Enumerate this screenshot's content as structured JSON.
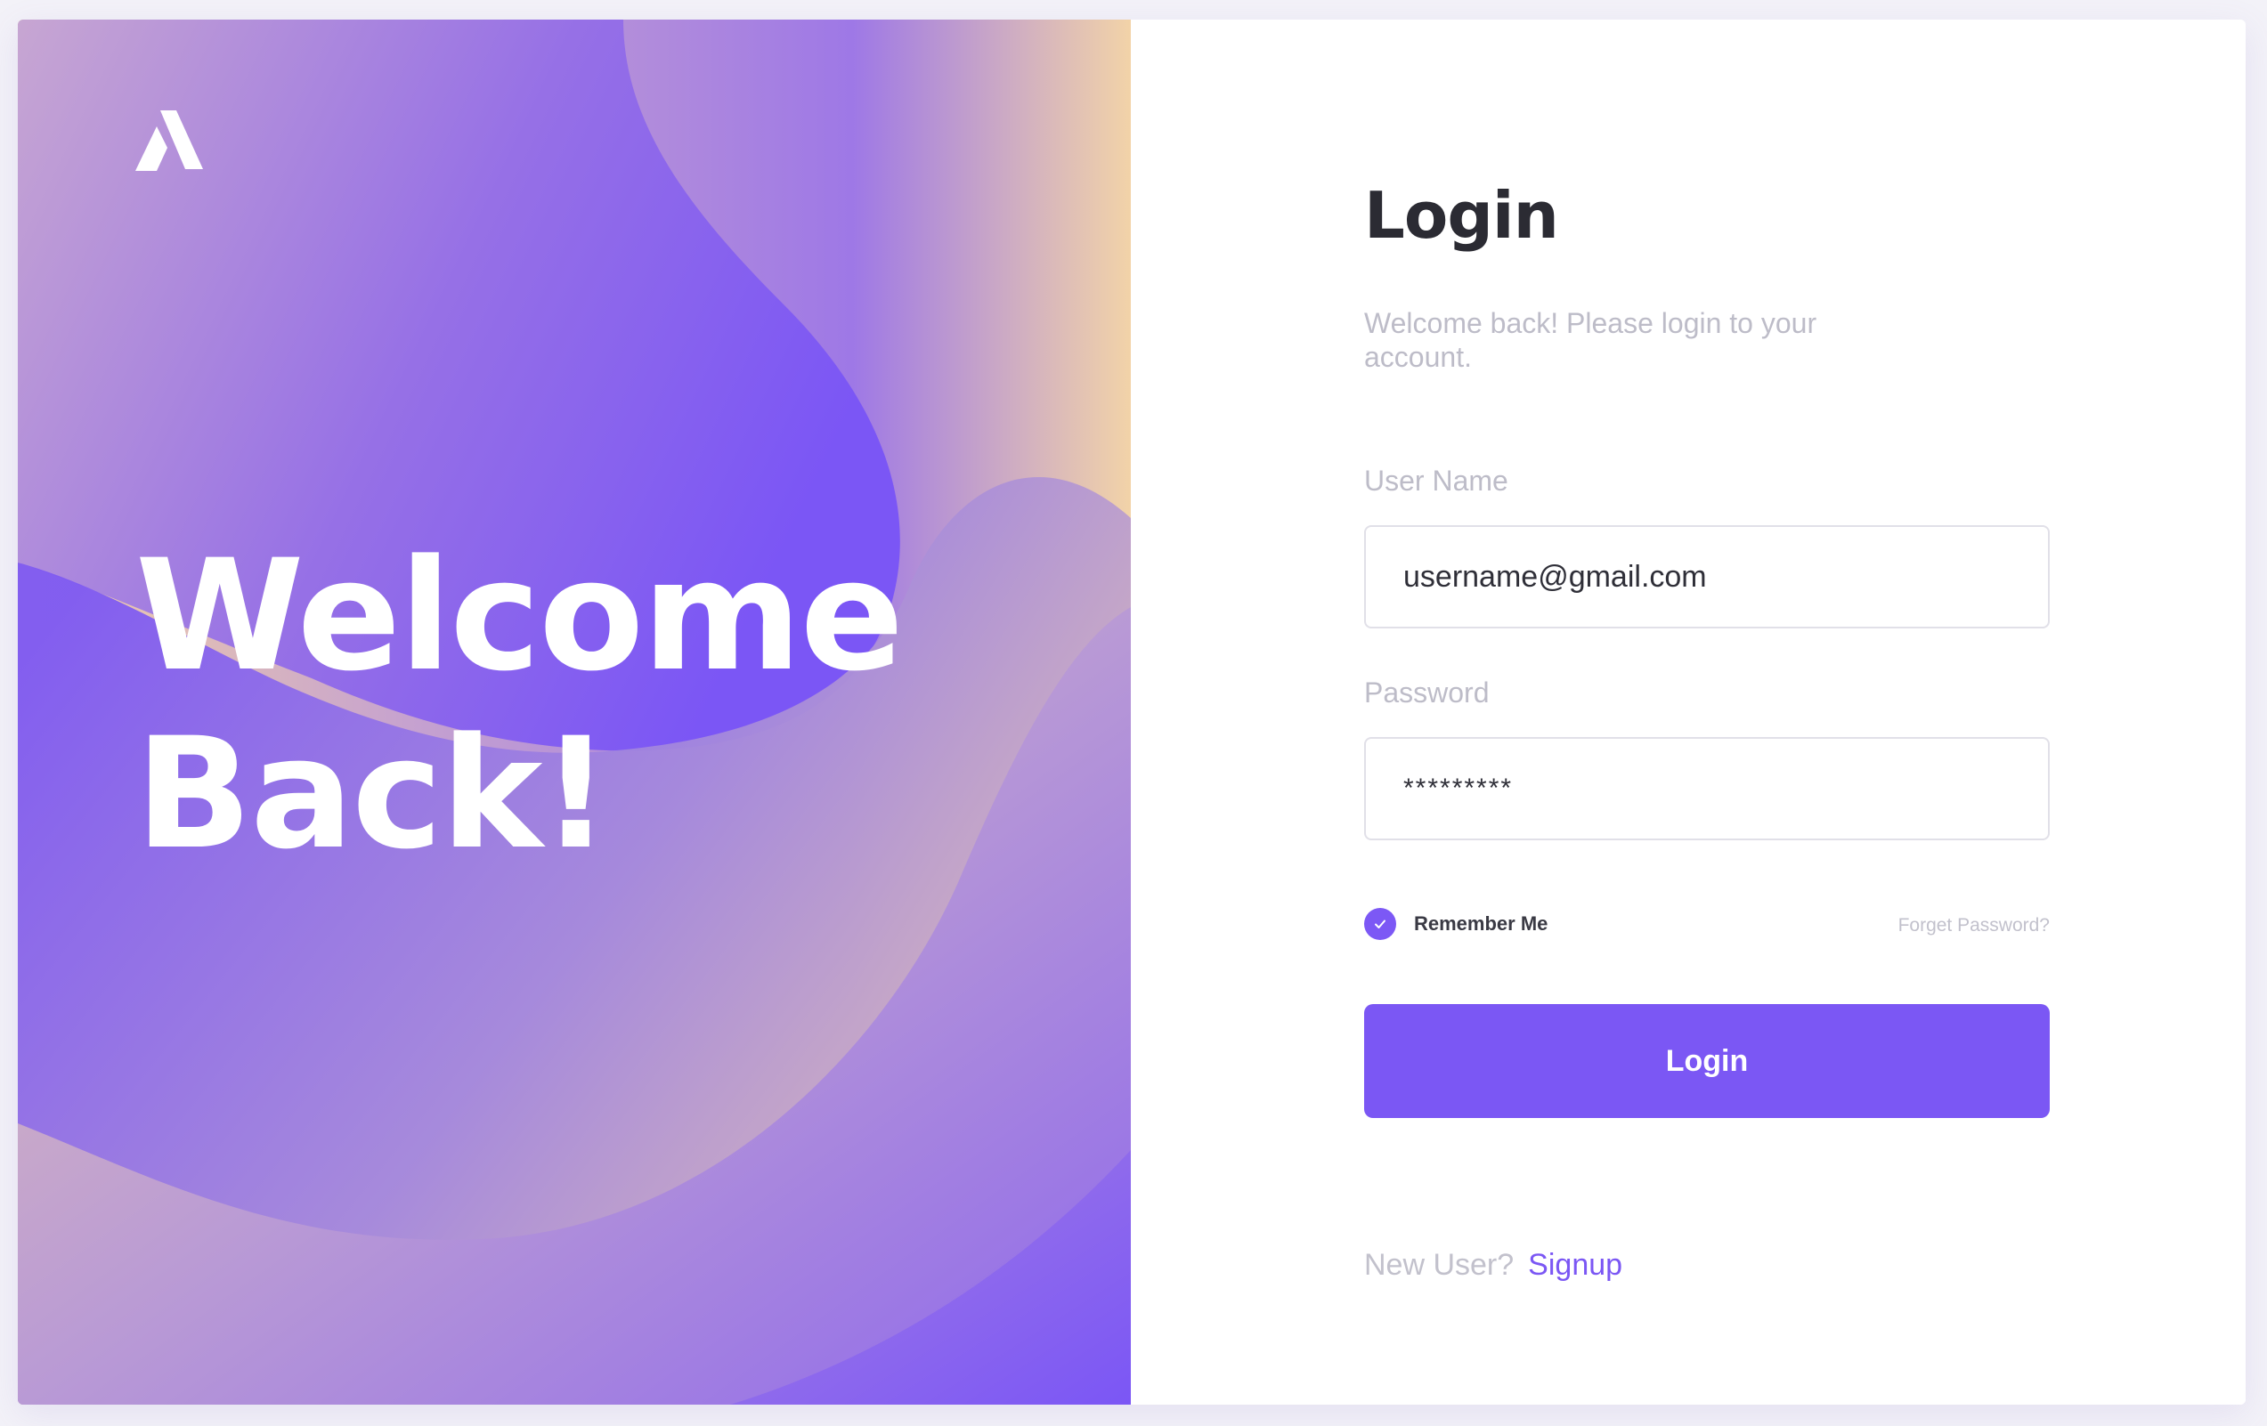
{
  "hero": {
    "title_line1": "Welcome",
    "title_line2": "Back!",
    "logo": "brand-logo-a-icon",
    "colors": {
      "purple": "#7c58f5",
      "peach": "#f5d6a8",
      "lavender": "#b594d8"
    }
  },
  "login": {
    "title": "Login",
    "subtitle": "Welcome back! Please login to your account.",
    "username_label": "User Name",
    "username_value": "username@gmail.com",
    "password_label": "Password",
    "password_value": "*********",
    "remember_label": "Remember Me",
    "remember_checked": true,
    "forgot_label": "Forget Password?",
    "button_label": "Login",
    "new_user_text": "New User?",
    "signup_label": "Signup",
    "accent_color": "#7b57f4"
  }
}
